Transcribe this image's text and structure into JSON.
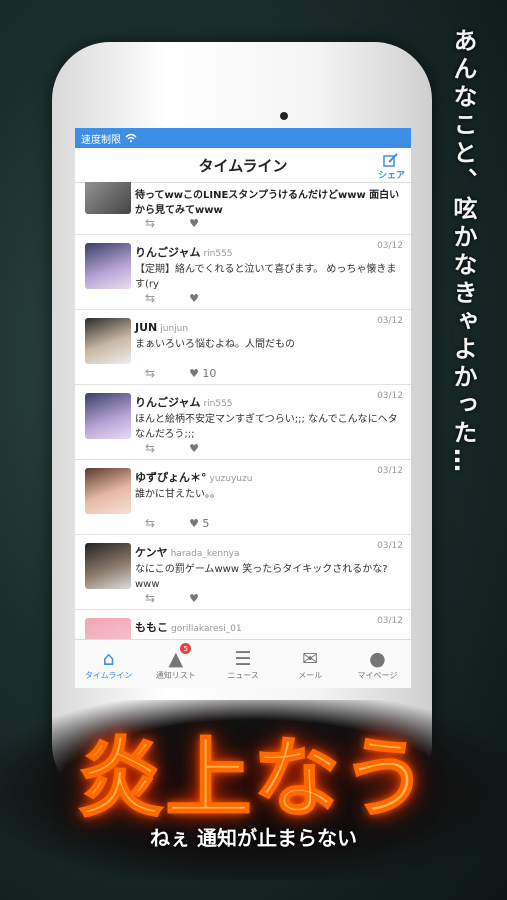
{
  "tagline": "あんなこと、呟かなきゃよかった…",
  "status": {
    "label": "速度制限"
  },
  "nav": {
    "title": "タイムライン",
    "share_label": "シェア"
  },
  "posts": [
    {
      "name": "",
      "handle": "",
      "date": "",
      "text": "待ってwwこのLINEスタンプうけるんだけどwww 面白いから見てみてwww",
      "likes": ""
    },
    {
      "name": "りんごジャム",
      "handle": "rin555",
      "date": "03/12",
      "text": "【定期】絡んでくれると泣いて喜びます。 めっちゃ懐きます(ry",
      "likes": ""
    },
    {
      "name": "JUN",
      "handle": "junjun",
      "date": "03/12",
      "text": "まぁいろいろ悩むよね。人間だもの",
      "likes": "10"
    },
    {
      "name": "りんごジャム",
      "handle": "rin555",
      "date": "03/12",
      "text": "ほんと絵柄不安定マンすぎてつらい;;; なんでこんなにヘタなんだろう;;;",
      "likes": ""
    },
    {
      "name": "ゆずぴょん＊°",
      "handle": "yuzuyuzu",
      "date": "03/12",
      "text": "誰かに甘えたい。。",
      "likes": "5"
    },
    {
      "name": "ケンヤ",
      "handle": "harada_kennya",
      "date": "03/12",
      "text": "なにこの罰ゲームwww 笑ったらタイキックされるかな?www",
      "likes": ""
    },
    {
      "name": "ももこ",
      "handle": "gorillakaresi_01",
      "date": "03/12",
      "text": "",
      "likes": ""
    }
  ],
  "tabs": [
    {
      "label": "タイムライン",
      "icon": "home-icon"
    },
    {
      "label": "通知リスト",
      "icon": "bell-icon",
      "badge": "5"
    },
    {
      "label": "ニュース",
      "icon": "news-icon"
    },
    {
      "label": "メール",
      "icon": "mail-icon"
    },
    {
      "label": "マイページ",
      "icon": "user-icon"
    }
  ],
  "logo": {
    "title": "炎上なう",
    "subtitle": "ねぇ 通知が止まらない"
  },
  "colors": {
    "accent": "#3d8ee6",
    "fire": "#ff6a00",
    "badge": "#e84040"
  }
}
